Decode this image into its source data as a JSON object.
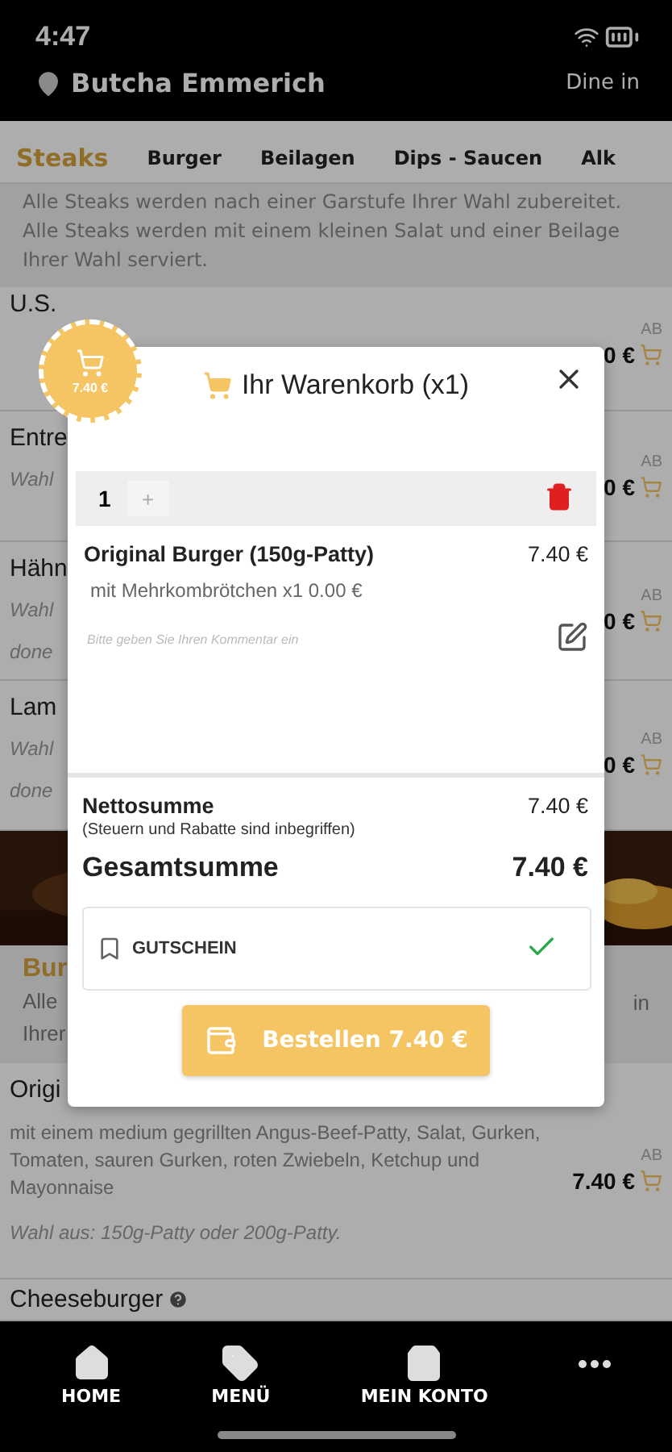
{
  "status_bar": {
    "time": "4:47"
  },
  "header": {
    "location": "Butcha Emmerich",
    "mode": "Dine in"
  },
  "categories": [
    {
      "label": "Steaks",
      "selected": true
    },
    {
      "label": "Burger",
      "selected": false
    },
    {
      "label": "Beilagen",
      "selected": false
    },
    {
      "label": "Dips - Saucen",
      "selected": false
    },
    {
      "label": "Alk",
      "selected": false
    }
  ],
  "category_description": "Alle Steaks werden nach einer Garstufe Ihrer Wahl zubereitet. Alle Steaks werden mit einem kleinen Salat und einer Beilage Ihrer Wahl serviert.",
  "steak_rows": [
    {
      "title": "U.S.",
      "lines": [],
      "tag": "AB",
      "price": "0 €"
    },
    {
      "title": "Entre",
      "lines": [
        "Wahl"
      ],
      "tag": "AB",
      "price": "0 €"
    },
    {
      "title": "Hähn",
      "lines": [
        "Wahl",
        "done"
      ],
      "tag": "AB",
      "price": "0 €"
    },
    {
      "title": "Lam",
      "lines": [
        "Wahl",
        "done"
      ],
      "tag": "AB",
      "price": "0 €"
    }
  ],
  "burger_section": {
    "title": "Bur",
    "lines": [
      "Alle",
      "Ihrer"
    ],
    "right_text": "in"
  },
  "burger_item": {
    "title": "Origi",
    "description": "mit einem medium gegrillten Angus-Beef-Patty, Salat, Gurken, Tomaten, sauren Gurken, roten Zwiebeln, Ketchup und Mayonnaise",
    "tag": "AB",
    "price": "7.40 €",
    "note": "Wahl aus: 150g-Patty oder 200g-Patty."
  },
  "next_item": {
    "title": "Cheeseburger",
    "help": true
  },
  "cart_badge": {
    "amount": "7.40 €"
  },
  "cart": {
    "title": "Ihr Warenkorb (x1)",
    "quantity": "1",
    "plus": "+",
    "item": {
      "name": "Original Burger (150g-Patty)",
      "price": "7.40 €",
      "option": "mit Mehrkombrötchen x1 0.00 €"
    },
    "comment": {
      "placeholder": "Bitte geben Sie Ihren Kommentar ein"
    },
    "net_label": "Nettosumme",
    "net_value": "7.40 €",
    "tax_note": "(Steuern und Rabatte sind inbegriffen)",
    "total_label": "Gesamtsumme",
    "total_value": "7.40 €",
    "voucher": "GUTSCHEIN",
    "order_button": "Bestellen 7.40 €"
  },
  "bottom_nav": [
    {
      "kind": "home",
      "label": "HOME"
    },
    {
      "kind": "tag",
      "label": "MENÜ"
    },
    {
      "kind": "bag",
      "label": "MEIN KONTO"
    },
    {
      "kind": "more"
    }
  ]
}
